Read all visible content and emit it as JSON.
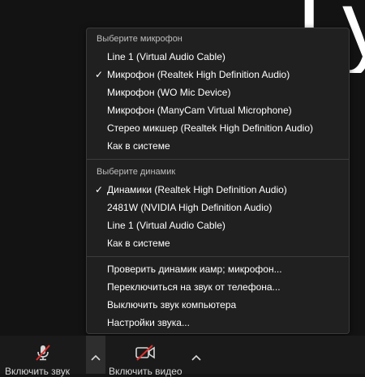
{
  "background": {
    "glyph": "Гу"
  },
  "menu": {
    "microphone_header": "Выберите микрофон",
    "microphones": [
      {
        "label": "Line 1 (Virtual Audio Cable)",
        "checked": false
      },
      {
        "label": "Микрофон (Realtek High Definition Audio)",
        "checked": true
      },
      {
        "label": "Микрофон (WO Mic Device)",
        "checked": false
      },
      {
        "label": "Микрофон (ManyCam Virtual Microphone)",
        "checked": false
      },
      {
        "label": "Стерео микшер (Realtek High Definition Audio)",
        "checked": false
      },
      {
        "label": "Как в системе",
        "checked": false
      }
    ],
    "speaker_header": "Выберите динамик",
    "speakers": [
      {
        "label": "Динамики (Realtek High Definition Audio)",
        "checked": true
      },
      {
        "label": "2481W (NVIDIA High Definition Audio)",
        "checked": false
      },
      {
        "label": "Line 1 (Virtual Audio Cable)",
        "checked": false
      },
      {
        "label": "Как в системе",
        "checked": false
      }
    ],
    "actions": [
      "Проверить динамик иамр; микрофон...",
      "Переключиться на звук от телефона...",
      "Выключить звук компьютера",
      "Настройки звука..."
    ],
    "check_glyph": "✓"
  },
  "toolbar": {
    "audio_label": "Включить звук",
    "video_label": "Включить видео"
  },
  "colors": {
    "mute_slash": "#e02f2f",
    "menu_bg": "#202020"
  }
}
